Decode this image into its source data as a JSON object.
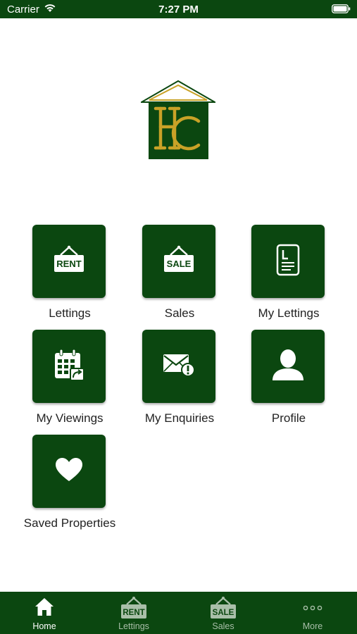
{
  "status_bar": {
    "carrier": "Carrier",
    "time": "7:27 PM"
  },
  "logo": {
    "letters": "HC"
  },
  "menu": {
    "items": [
      {
        "label": "Lettings",
        "icon": "rent-sign-icon",
        "badge": "RENT"
      },
      {
        "label": "Sales",
        "icon": "sale-sign-icon",
        "badge": "SALE"
      },
      {
        "label": "My Lettings",
        "icon": "document-icon"
      },
      {
        "label": "My Viewings",
        "icon": "calendar-share-icon"
      },
      {
        "label": "My Enquiries",
        "icon": "envelope-alert-icon"
      },
      {
        "label": "Profile",
        "icon": "person-icon"
      },
      {
        "label": "Saved Properties",
        "icon": "heart-icon"
      }
    ]
  },
  "tab_bar": {
    "tabs": [
      {
        "label": "Home",
        "icon": "home-icon",
        "active": true
      },
      {
        "label": "Lettings",
        "icon": "rent-sign-icon",
        "badge": "RENT"
      },
      {
        "label": "Sales",
        "icon": "sale-sign-icon",
        "badge": "SALE"
      },
      {
        "label": "More",
        "icon": "more-dots-icon"
      }
    ]
  },
  "colors": {
    "brand_green": "#0b4710",
    "logo_gold": "#c9a227",
    "tab_inactive": "#a9bfa9"
  }
}
